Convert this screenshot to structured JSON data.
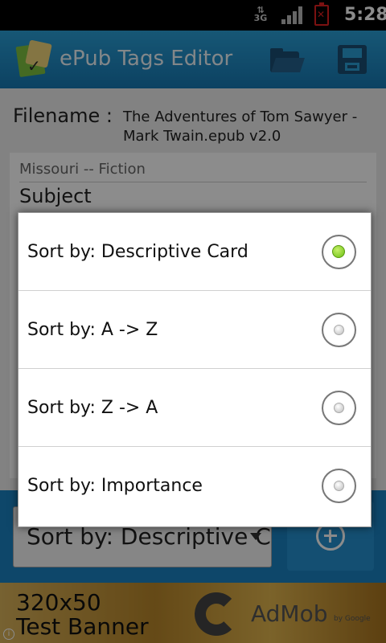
{
  "status_bar": {
    "network": "3G",
    "time": "5:28",
    "icons": [
      "data-transfer-icon",
      "signal-strength-icon",
      "battery-alert-icon"
    ]
  },
  "title_bar": {
    "app_title": "ePub Tags Editor",
    "icons": [
      "app-logo-icon",
      "folder-open-icon",
      "save-floppy-icon"
    ]
  },
  "main": {
    "filename_label": "Filename :",
    "filename_value": "The Adventures of Tom Sawyer - Mark Twain.epub v2.0",
    "list_prev_item": "Missouri -- Fiction",
    "list_section": "Subject",
    "sort_spinner_value": "Sort by: Descriptive Card",
    "add_icon": "add-circle-icon"
  },
  "dialog": {
    "options": [
      {
        "label": "Sort by: Descriptive Card",
        "checked": true
      },
      {
        "label": "Sort by: A -> Z",
        "checked": false
      },
      {
        "label": "Sort by: Z -> A",
        "checked": false
      },
      {
        "label": "Sort by: Importance",
        "checked": false
      }
    ]
  },
  "ad_banner": {
    "text": "320x50 Test Banner",
    "line1": "320x50",
    "line2": "Test Banner",
    "brand": "AdMob",
    "brand_suffix": "by Google"
  },
  "colors": {
    "title_bar": "#1e8bc8",
    "dialog_background": "#ffffff",
    "radio_checked": "#6abf10",
    "battery_alert": "#e02020"
  }
}
